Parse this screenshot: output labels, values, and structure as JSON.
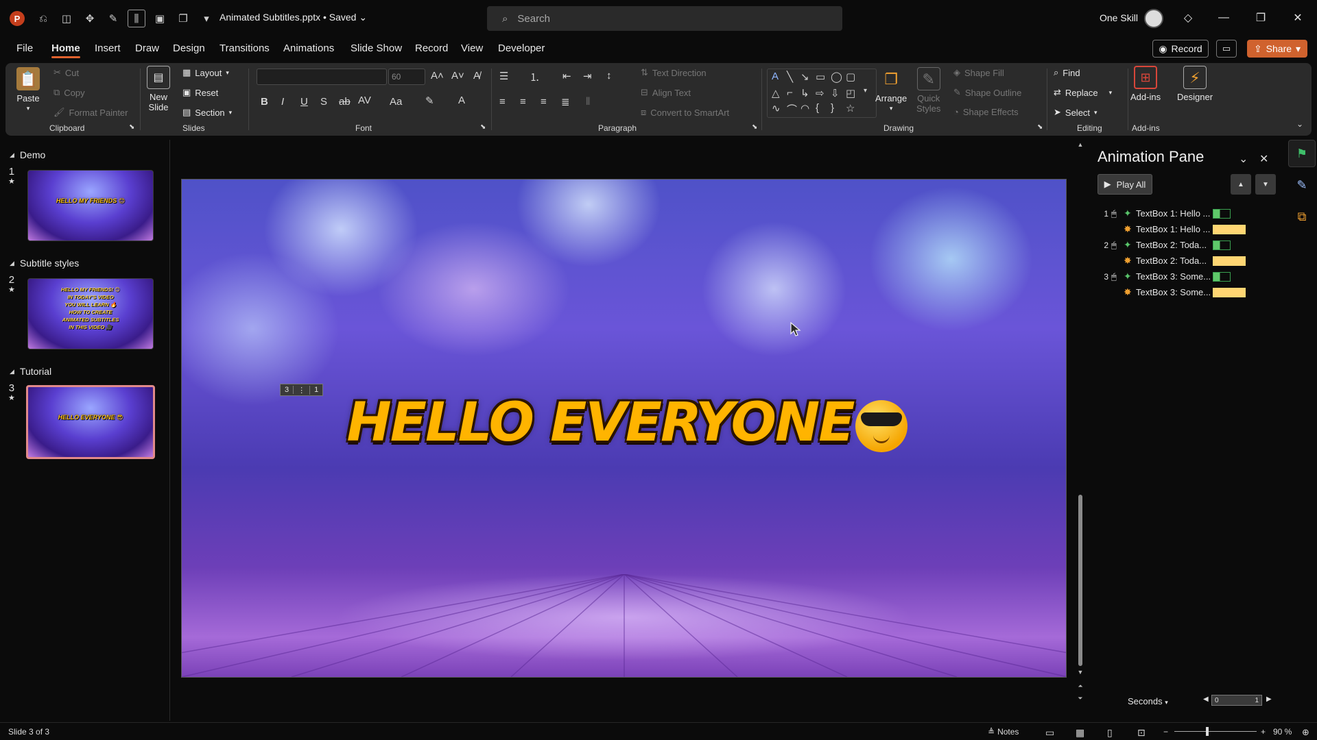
{
  "app": {
    "logo_letter": "P",
    "doc_title": "Animated Subtitles.pptx • Saved ⌄",
    "search_placeholder": "Search",
    "user_name": "One Skill"
  },
  "tabs": [
    "File",
    "Home",
    "Insert",
    "Draw",
    "Design",
    "Transitions",
    "Animations",
    "Slide Show",
    "Record",
    "View",
    "Developer"
  ],
  "active_tab": "Home",
  "header_buttons": {
    "record": "Record",
    "share": "Share"
  },
  "ribbon": {
    "clipboard": {
      "label": "Clipboard",
      "paste": "Paste",
      "cut": "Cut",
      "copy": "Copy",
      "format_painter": "Format Painter"
    },
    "slides": {
      "label": "Slides",
      "new_slide_line1": "New",
      "new_slide_line2": "Slide",
      "layout": "Layout",
      "reset": "Reset",
      "section": "Section"
    },
    "font": {
      "label": "Font",
      "font_size": "60"
    },
    "paragraph": {
      "label": "Paragraph",
      "text_direction": "Text Direction",
      "align_text": "Align Text",
      "convert_smartart": "Convert to SmartArt"
    },
    "drawing": {
      "label": "Drawing",
      "arrange": "Arrange",
      "quick_styles_line1": "Quick",
      "quick_styles_line2": "Styles",
      "shape_fill": "Shape Fill",
      "shape_outline": "Shape Outline",
      "shape_effects": "Shape Effects"
    },
    "editing": {
      "label": "Editing",
      "find": "Find",
      "replace": "Replace",
      "select": "Select"
    },
    "addins": {
      "label": "Add-ins",
      "addins_btn": "Add-ins",
      "designer": "Designer"
    }
  },
  "slides_panel": {
    "sections": [
      {
        "name": "Demo",
        "slide_number": "1",
        "thumb_text": "HELLO MY FRIENDS 😊"
      },
      {
        "name": "Subtitle styles",
        "slide_number": "2",
        "thumb_lines": [
          "HELLO MY FRIENDS! 😊",
          "IN TODAY'S VIDEO",
          "YOU WILL LEARN 🔥",
          "HOW TO CREATE",
          "ANIMATED SUBTITLES",
          "IN THIS VIDEO 🎥"
        ]
      },
      {
        "name": "Tutorial",
        "slide_number": "3",
        "thumb_text": "HELLO EVERYONE 😎"
      }
    ],
    "star": "★"
  },
  "slide": {
    "subtitle_text_before": "HELLO EVERYONE",
    "anim_tags": [
      "3",
      "⋮",
      "1"
    ]
  },
  "animation_pane": {
    "title": "Animation Pane",
    "play_all": "Play All",
    "items": [
      {
        "num": "1",
        "mouse": true,
        "kind": "entrance",
        "label": "TextBox 1: Hello ...",
        "bar": "green"
      },
      {
        "num": "",
        "mouse": false,
        "kind": "emphasis",
        "label": "TextBox 1: Hello ...",
        "bar": "yellow"
      },
      {
        "num": "2",
        "mouse": true,
        "kind": "entrance",
        "label": "TextBox 2: Toda...",
        "bar": "green"
      },
      {
        "num": "",
        "mouse": false,
        "kind": "emphasis",
        "label": "TextBox 2: Toda...",
        "bar": "yellow"
      },
      {
        "num": "3",
        "mouse": true,
        "kind": "entrance",
        "label": "TextBox 3: Some...",
        "bar": "green"
      },
      {
        "num": "",
        "mouse": false,
        "kind": "emphasis",
        "label": "TextBox 3: Some...",
        "bar": "yellow"
      }
    ],
    "seconds": "Seconds",
    "timeline_start": "0",
    "timeline_end": "1"
  },
  "statusbar": {
    "slide_info": "Slide 3 of 3",
    "notes": "Notes",
    "zoom": "90 %"
  },
  "colors": {
    "accent": "#e0622e",
    "share_bg": "#d0622e",
    "subtitle_fill": "#ffb400",
    "selected_thumb_border": "#e28a8a",
    "emphasis_bar": "#ffd673",
    "entrance_bar": "#5fc86a"
  }
}
